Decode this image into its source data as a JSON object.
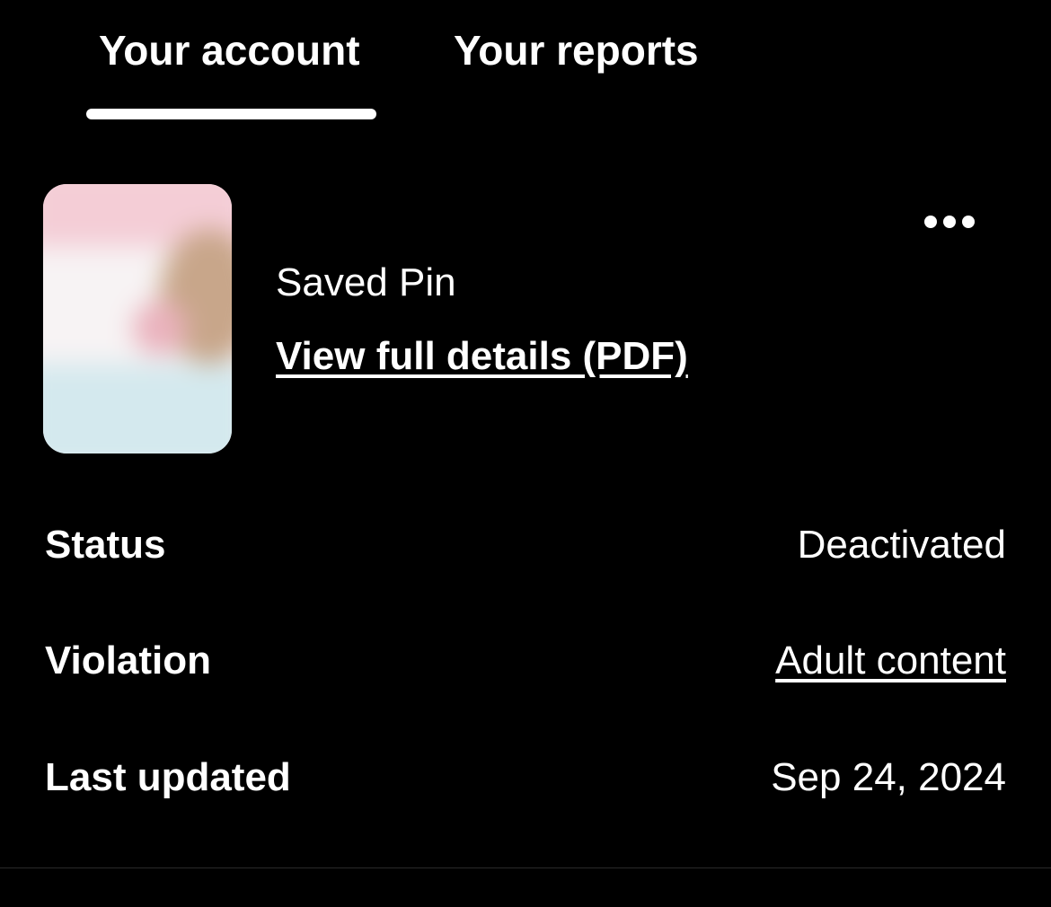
{
  "tabs": [
    {
      "label": "Your account",
      "selected": true
    },
    {
      "label": "Your reports",
      "selected": false
    }
  ],
  "item": {
    "type_label": "Saved Pin",
    "details_link": "View full details (PDF)",
    "thumbnail": "blurred-pin-image",
    "more_icon": "more-horizontal-icon"
  },
  "details": {
    "status": {
      "label": "Status",
      "value": "Deactivated"
    },
    "violation": {
      "label": "Violation",
      "value": "Adult content"
    },
    "last_updated": {
      "label": "Last updated",
      "value": "Sep 24, 2024"
    }
  },
  "colors": {
    "background": "#000000",
    "text": "#ffffff",
    "divider": "#2a2a2a"
  }
}
